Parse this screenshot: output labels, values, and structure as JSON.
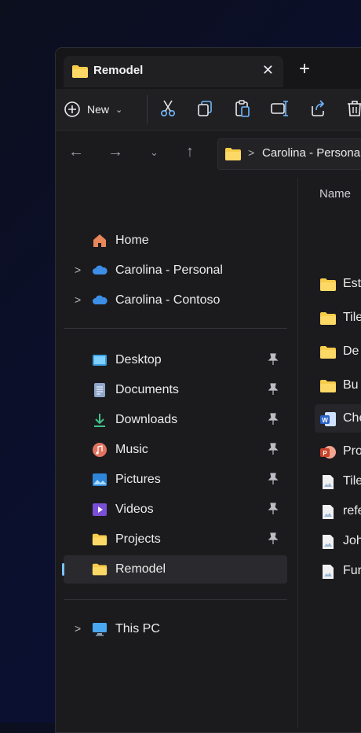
{
  "tab": {
    "title": "Remodel",
    "close_glyph": "✕",
    "new_tab_glyph": "+"
  },
  "toolbar": {
    "new_label": "New"
  },
  "address": {
    "crumb": "Carolina - Persona"
  },
  "sidebar": {
    "items": [
      {
        "label": "Home",
        "icon": "home-icon"
      },
      {
        "label": "Carolina - Personal",
        "icon": "cloud-icon"
      },
      {
        "label": "Carolina - Contoso",
        "icon": "cloud-icon"
      },
      {
        "label": "Desktop",
        "icon": "desktop-icon"
      },
      {
        "label": "Documents",
        "icon": "documents-icon"
      },
      {
        "label": "Downloads",
        "icon": "downloads-icon"
      },
      {
        "label": "Music",
        "icon": "music-icon"
      },
      {
        "label": "Pictures",
        "icon": "pictures-icon"
      },
      {
        "label": "Videos",
        "icon": "videos-icon"
      },
      {
        "label": "Projects",
        "icon": "folder-icon"
      },
      {
        "label": "Remodel",
        "icon": "folder-icon"
      },
      {
        "label": "This PC",
        "icon": "pc-icon"
      }
    ]
  },
  "content": {
    "column_header": "Name",
    "files": [
      {
        "label": "Est",
        "icon": "folder-icon"
      },
      {
        "label": "Tile",
        "icon": "folder-icon"
      },
      {
        "label": "De",
        "icon": "folder-icon"
      },
      {
        "label": "Bu",
        "icon": "folder-icon"
      },
      {
        "label": "Che",
        "icon": "word-icon"
      },
      {
        "label": "Proj",
        "icon": "powerpoint-icon"
      },
      {
        "label": "Tile",
        "icon": "image-file-icon"
      },
      {
        "label": "refe",
        "icon": "image-file-icon"
      },
      {
        "label": "Joh",
        "icon": "image-file-icon"
      },
      {
        "label": "Fur",
        "icon": "image-file-icon"
      }
    ]
  },
  "colors": {
    "accent": "#7cc2ff",
    "folder": "#f7cc4a",
    "window_bg": "#1b1b1e"
  }
}
